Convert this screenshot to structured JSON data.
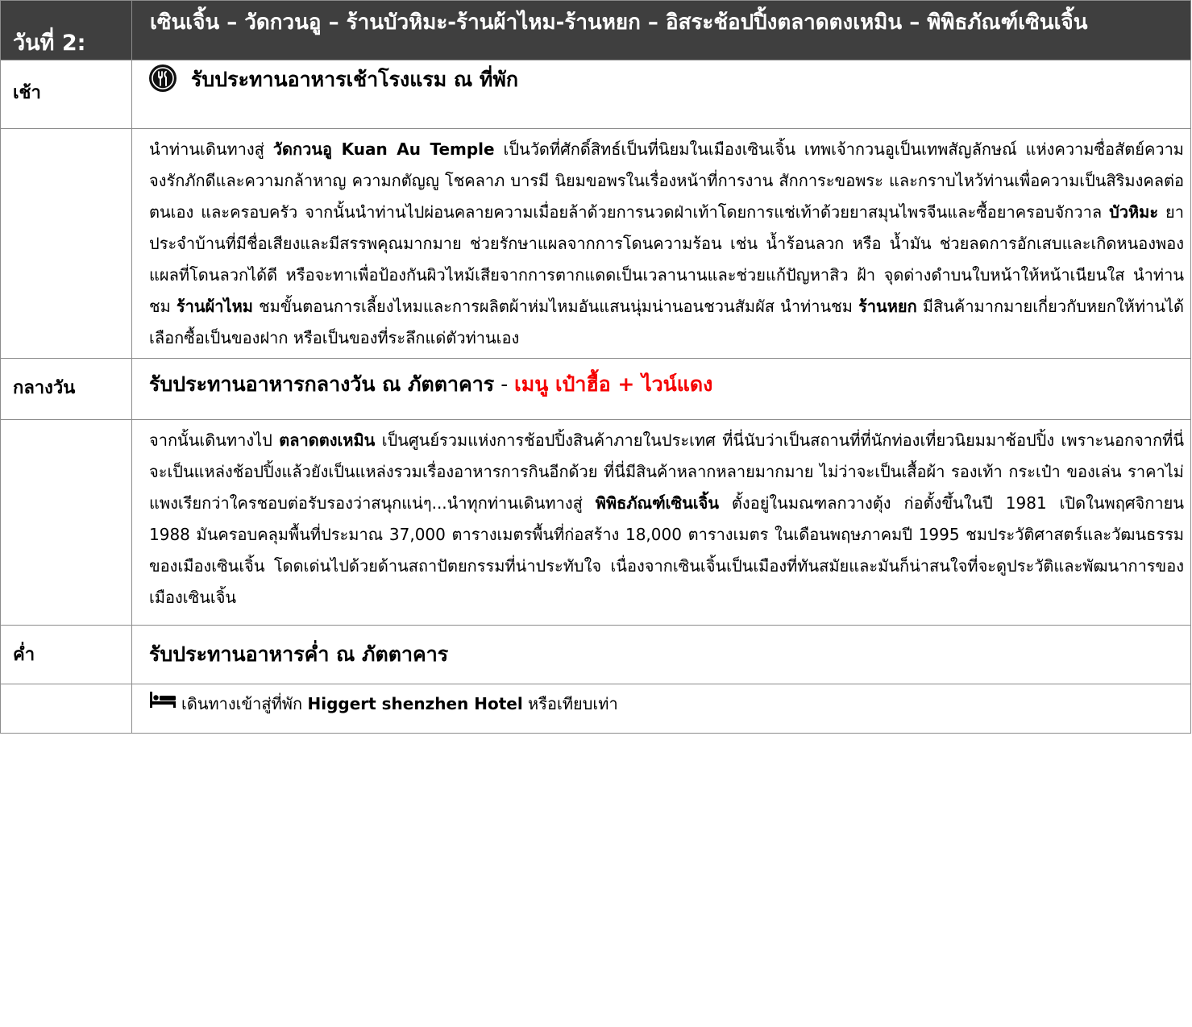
{
  "day": {
    "label": "วันที่ 2:",
    "title": "เซินเจิ้น – วัดกวนอู –  ร้านบัวหิมะ-ร้านผ้าไหม-ร้านหยก – อิสระช้อปปิ้งตลาดตงเหมิน – พิพิธภัณฑ์เซินเจิ้น"
  },
  "breakfast": {
    "label": "เช้า",
    "icon": "restaurant-icon",
    "text": "รับประทานอาหารเช้าโรงแรม ณ ที่พัก"
  },
  "morning_desc": {
    "p1": "นำท่านเดินทางสู่ ",
    "b1": "วัดกวนอู Kuan Au Temple",
    "p2": " เป็นวัดที่ศักดิ์สิทธ์เป็นที่นิยมในเมืองเซินเจิ้น เทพเจ้ากวนอูเป็นเทพสัญลักษณ์ แห่งความซื่อสัตย์ความจงรักภักดีและความกล้าหาญ ความกตัญญู โชคลาภ บารมี นิยมขอพรในเรื่องหน้าที่การงาน สักการะขอพระ และกราบไหว้ท่านเพื่อความเป็นสิริมงคลต่อตนเอง และครอบครัว จากนั้นนำท่านไปผ่อนคลายความเมื่อยล้าด้วยการนวดฝ่าเท้าโดยการแช่เท้าด้วยยาสมุนไพรจีนและซื้อยาครอบจักวาล ",
    "b2": "บัวหิมะ",
    "p3": " ยาประจำบ้านที่มีชื่อเสียงและมีสรรพคุณมากมาย ช่วยรักษาแผลจากการโดนความร้อน เช่น น้ำร้อนลวก หรือ น้ำมัน ช่วยลดการอักเสบและเกิดหนองพองแผลที่โดนลวกได้ดี หรือจะทาเพื่อป้องกันผิวไหม้เสียจากการตากแดดเป็นเวลานานและช่วยแก้ปัญหาสิว ฝ้า จุดด่างดำบนใบหน้าให้หน้าเนียนใส นำท่านชม ",
    "b3": "ร้านผ้าไหม",
    "p4": " ชมขั้นตอนการเลี้ยงไหมและการผลิตผ้าห่มไหมอันแสนนุ่มน่านอนชวนสัมผัส นำท่านชม ",
    "b4": "ร้านหยก",
    "p5": " มีสินค้ามากมายเกี่ยวกับหยกให้ท่านได้เลือกซื้อเป็นของฝาก หรือเป็นของที่ระลึกแด่ตัวท่านเอง"
  },
  "lunch": {
    "label": "กลางวัน",
    "text": "รับประทานอาหารกลางวัน ณ ภัตตาคาร",
    "separator": " - ",
    "menu": "เมนู เป๋าฮื้อ + ไวน์แดง",
    "menu_color": "#f50000"
  },
  "afternoon_desc": {
    "p1": "จากนั้นเดินทางไป ",
    "b1": "ตลาดตงเหมิน",
    "p2": " เป็นศูนย์รวมแห่งการช้อปปิ้งสินค้าภายในประเทศ ที่นี่นับว่าเป็นสถานที่ที่นักท่องเที่ยวนิยมมาช้อปปิ้ง เพราะนอกจากที่นี่จะเป็นแหล่งช้อปปิ้งแล้วยังเป็นแหล่งรวมเรื่องอาหารการกินอีกด้วย ที่นี่มีสินค้าหลากหลายมากมาย ไม่ว่าจะเป็นเสื้อผ้า รองเท้า กระเป๋า ของเล่น ราคาไม่แพงเรียกว่าใครชอบต่อรับรองว่าสนุกแน่ๆ...นำทุกท่านเดินทางสู่ ",
    "b2": "พิพิธภัณฑ์เซินเจิ้น",
    "p3": "  ตั้งอยู่ในมณฑลกวางตุ้ง ก่อตั้งขึ้นในปี 1981 เปิดในพฤศจิกายน 1988 มันครอบคลุมพื้นที่ประมาณ 37,000 ตารางเมตรพื้นที่ก่อสร้าง 18,000 ตารางเมตร ในเดือนพฤษภาคมปี 1995 ชมประวัติศาสตร์และวัฒนธรรมของเมืองเซินเจิ้น โดดเด่นไปด้วยด้านสถาปัตยกรรมที่น่าประทับใจ เนื่องจากเซินเจิ้นเป็นเมืองที่ทันสมัยและมันก็น่าสนใจที่จะดูประวัติและพัฒนาการของเมืองเซินเจิ้น"
  },
  "dinner": {
    "label": "ค่ำ",
    "text": "รับประทานอาหารค่ำ ณ ภัตตาคาร"
  },
  "hotel": {
    "icon": "bed-icon",
    "p1": "เดินทางเข้าสู่ที่พัก ",
    "b1": "Higgert shenzhen  Hotel",
    "p2": " หรือเทียบเท่า"
  },
  "colors": {
    "header_bg": "#3f3f3f",
    "day_label": "#f5c342",
    "border": "#8c8c8c"
  }
}
